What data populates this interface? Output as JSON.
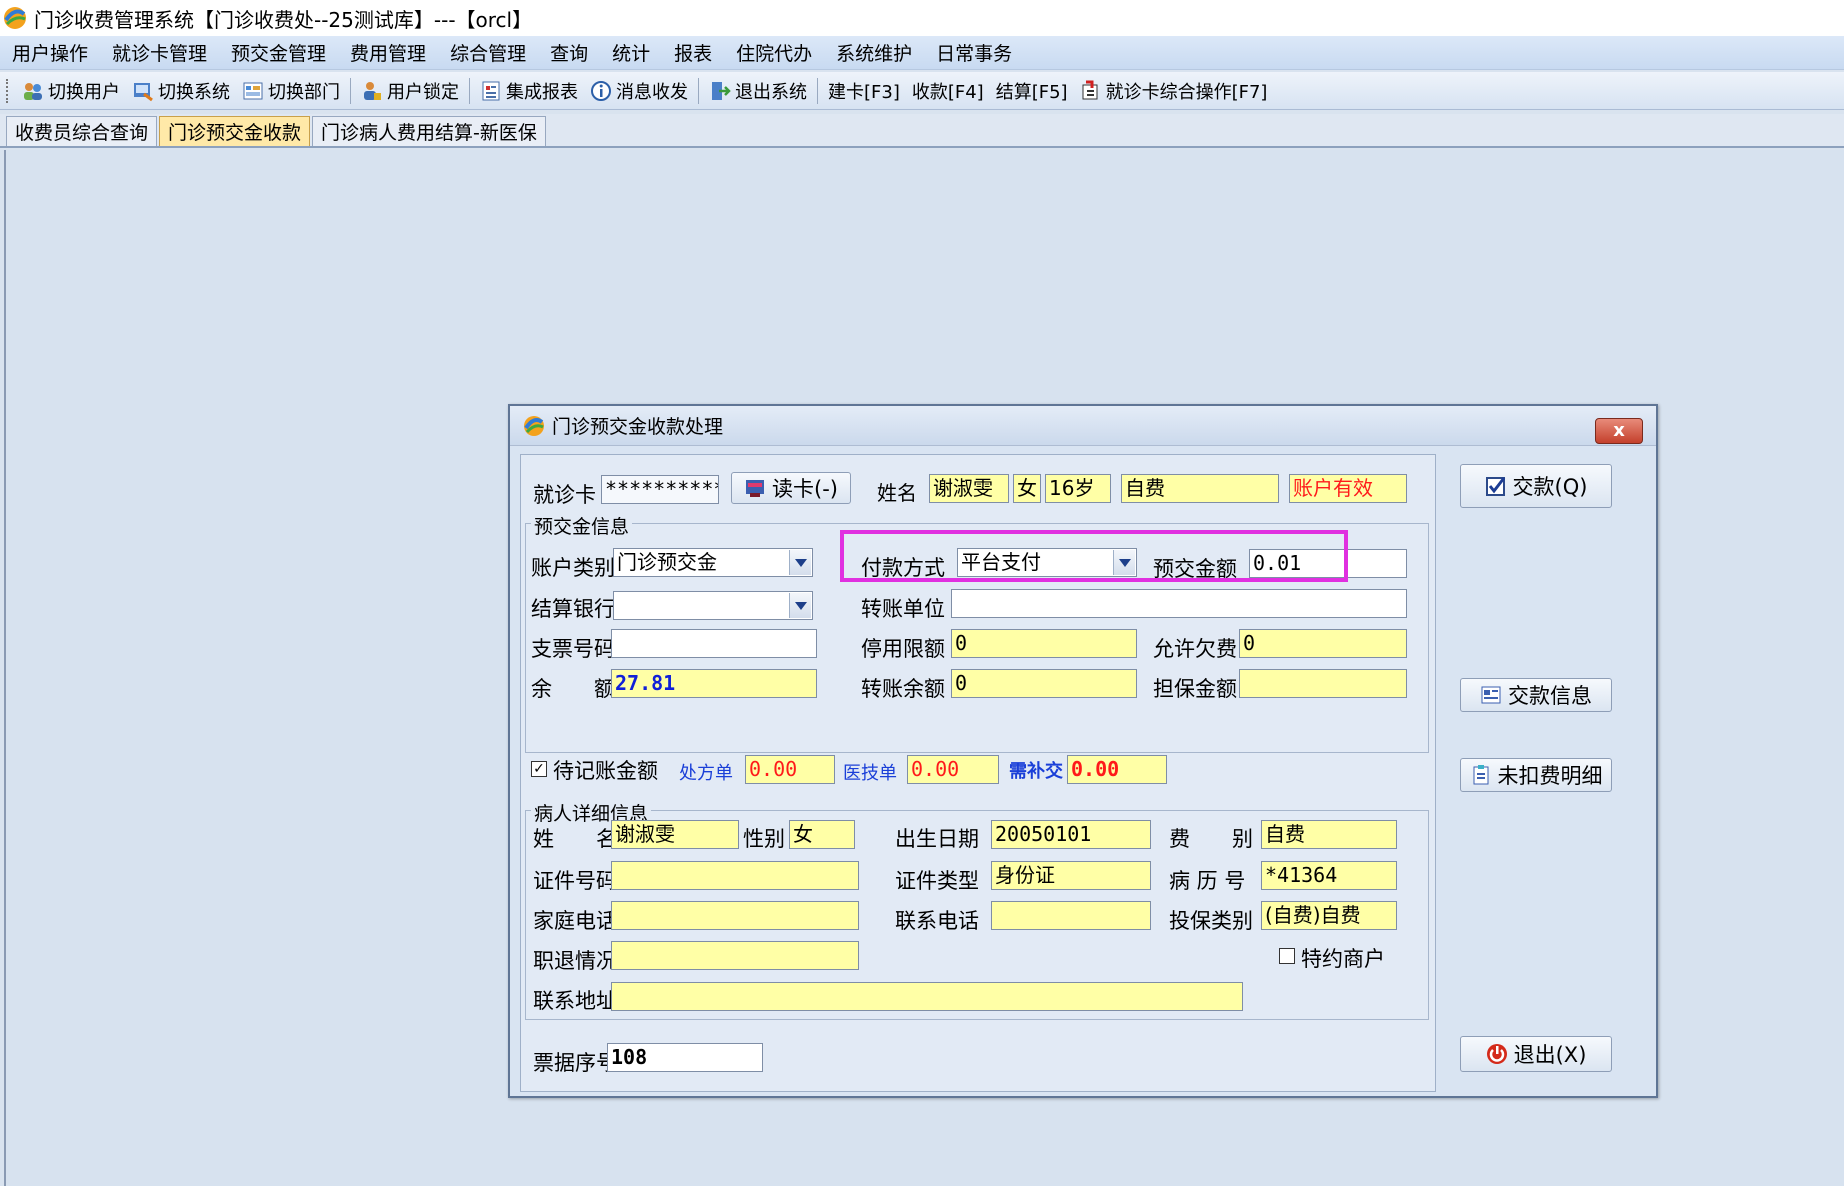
{
  "window": {
    "title": "门诊收费管理系统【门诊收费处--25测试库】---【orcl】"
  },
  "menu": [
    "用户操作",
    "就诊卡管理",
    "预交金管理",
    "费用管理",
    "综合管理",
    "查询",
    "统计",
    "报表",
    "住院代办",
    "系统维护",
    "日常事务"
  ],
  "toolbar": [
    {
      "label": "切换用户",
      "icon": "users-icon"
    },
    {
      "label": "切换系统",
      "icon": "switch-system-icon"
    },
    {
      "label": "切换部门",
      "icon": "department-icon"
    },
    {
      "label": "用户锁定",
      "icon": "user-lock-icon"
    },
    {
      "label": "集成报表",
      "icon": "report-icon"
    },
    {
      "label": "消息收发",
      "icon": "info-icon"
    },
    {
      "label": "退出系统",
      "icon": "exit-icon"
    },
    {
      "label": "建卡[F3]",
      "icon": ""
    },
    {
      "label": "收款[F4]",
      "icon": ""
    },
    {
      "label": "结算[F5]",
      "icon": ""
    },
    {
      "label": "就诊卡综合操作[F7]",
      "icon": "card-ops-icon"
    }
  ],
  "tabs": [
    {
      "label": "收费员综合查询",
      "active": false
    },
    {
      "label": "门诊预交金收款",
      "active": true
    },
    {
      "label": "门诊病人费用结算-新医保",
      "active": false
    }
  ],
  "dialog": {
    "title": "门诊预交金收款处理",
    "close": "x",
    "card_label": "就诊卡",
    "card_value": "***********",
    "read_card_button": "读卡(-)",
    "name_label": "姓名",
    "name_value": "谢淑雯",
    "gender_value": "女",
    "age_value": "16岁",
    "fee_type_value": "自费",
    "account_status": "账户有效",
    "prepay_group_title": "预交金信息",
    "account_type_label": "账户类别",
    "account_type_value": "门诊预交金",
    "pay_method_label": "付款方式",
    "pay_method_value": "平台支付",
    "prepay_amount_label": "预交金额",
    "prepay_amount_value": "0.01",
    "settle_bank_label": "结算银行",
    "settle_bank_value": "",
    "transfer_unit_label": "转账单位",
    "transfer_unit_value": "",
    "cheque_label": "支票号码",
    "cheque_value": "",
    "stop_limit_label": "停用限额",
    "stop_limit_value": "0",
    "allow_debt_label": "允许欠费",
    "allow_debt_value": "0",
    "balance_label": "余　　额",
    "balance_value": "27.81",
    "transfer_balance_label": "转账余额",
    "transfer_balance_value": "0",
    "guarantee_label": "担保金额",
    "guarantee_value": "",
    "pending_label": "待记账金额",
    "pending_checked": "✓",
    "prescription_label": "处方单",
    "prescription_value": "0.00",
    "medtech_label": "医技单",
    "medtech_value": "0.00",
    "need_pay_label": "需补交",
    "need_pay_value": "0.00",
    "patient_group_title": "病人详细信息",
    "p_name_label": "姓　　名",
    "p_name_value": "谢淑雯",
    "p_gender_label": "性别",
    "p_gender_value": "女",
    "p_birth_label": "出生日期",
    "p_birth_value": "20050101",
    "p_feetype_label": "费　　别",
    "p_feetype_value": "自费",
    "p_idno_label": "证件号码",
    "p_idno_value": "",
    "p_idtype_label": "证件类型",
    "p_idtype_value": "身份证",
    "p_record_label": "病 历 号",
    "p_record_value": "*41364",
    "p_homephone_label": "家庭电话",
    "p_homephone_value": "",
    "p_contact_label": "联系电话",
    "p_contact_value": "",
    "p_insure_label": "投保类别",
    "p_insure_value": "(自费)自费",
    "p_job_label": "职退情况",
    "p_job_value": "",
    "p_special_label": "特约商户",
    "p_address_label": "联系地址",
    "p_address_value": "",
    "receipt_label": "票据序号",
    "receipt_value": "108",
    "btn_pay": "交款(Q)",
    "btn_payinfo": "交款信息",
    "btn_undeducted": "未扣费明细",
    "btn_exit": "退出(X)"
  },
  "colors": {
    "highlight": "#e030e0",
    "yellow_field": "#ffffa6",
    "status_red": "#ff1a1a",
    "balance_blue": "#1020d8"
  }
}
